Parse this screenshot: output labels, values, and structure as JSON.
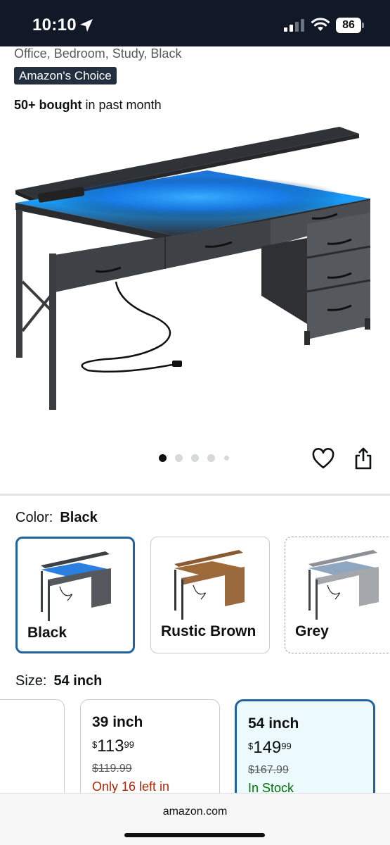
{
  "status_bar": {
    "time": "10:10",
    "battery": "86",
    "icons": [
      "location-arrow-icon",
      "cellular-signal-icon",
      "wifi-icon",
      "battery-icon"
    ]
  },
  "product": {
    "title_tail": "Office, Bedroom, Study, Black",
    "badge": "Amazon's Choice",
    "bought_bold": "50+ bought",
    "bought_rest": " in past month",
    "image_carousel": {
      "count": 5,
      "active": 1
    }
  },
  "actions": {
    "icons": [
      "heart-icon",
      "share-icon"
    ]
  },
  "color_selector": {
    "label": "Color:",
    "selected": "Black",
    "options": [
      {
        "label": "Black",
        "selected": true,
        "top_color": "#3d4044",
        "drawer_color": "#55585c"
      },
      {
        "label": "Rustic Brown",
        "selected": false,
        "top_color": "#8a5a30",
        "drawer_color": "#9a6a3e"
      },
      {
        "label": "Grey",
        "selected": false,
        "top_color": "#8d9096",
        "drawer_color": "#a4a7ab"
      }
    ]
  },
  "size_selector": {
    "label": "Size:",
    "selected": "54 inch",
    "options": [
      {
        "name": "39 inch",
        "price_symbol": "$",
        "price_whole": "113",
        "price_fraction": "99",
        "list_price": "$119.99",
        "availability": "Only 16 left in",
        "in_stock": false,
        "selected": false
      },
      {
        "name": "54 inch",
        "price_symbol": "$",
        "price_whole": "149",
        "price_fraction": "99",
        "list_price": "$167.99",
        "availability": "In Stock",
        "in_stock": true,
        "selected": true
      }
    ]
  },
  "browser": {
    "domain": "amazon.com"
  },
  "colors": {
    "selected_border": "#2162a1",
    "badge_bg": "#232f3e",
    "price_red": "#b12704",
    "stock_green": "#007600",
    "led_blue": "#1e8cff"
  }
}
